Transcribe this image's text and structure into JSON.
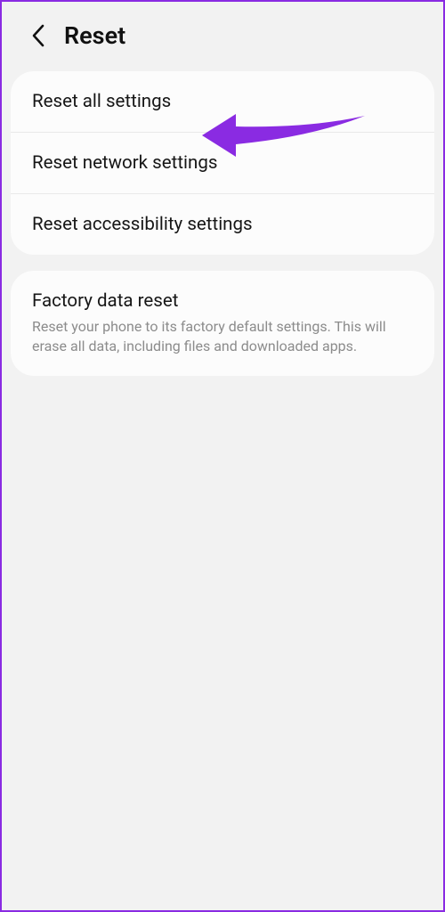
{
  "header": {
    "title": "Reset"
  },
  "group1": {
    "items": [
      {
        "title": "Reset all settings"
      },
      {
        "title": "Reset network settings"
      },
      {
        "title": "Reset accessibility settings"
      }
    ]
  },
  "group2": {
    "items": [
      {
        "title": "Factory data reset",
        "desc": "Reset your phone to its factory default settings. This will erase all data, including files and downloaded apps."
      }
    ]
  },
  "annotation": {
    "arrow_color": "#8a2be2"
  }
}
